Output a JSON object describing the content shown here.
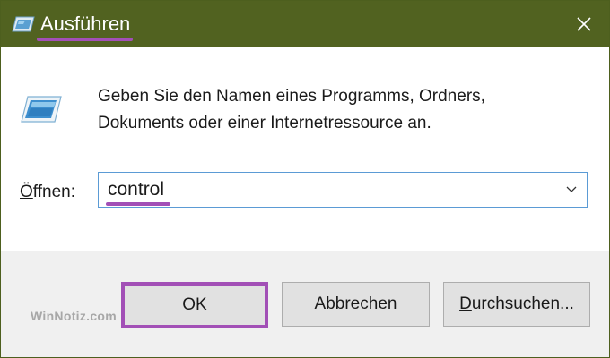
{
  "window": {
    "title": "Ausführen",
    "close_icon": "close-icon",
    "app_icon": "run-app-icon"
  },
  "content": {
    "icon": "run-dialog-icon",
    "description_line1": "Geben Sie den Namen eines Programms, Ordners,",
    "description_line2": "Dokuments oder einer Internetressource an.",
    "open_label_access_key": "Ö",
    "open_label_rest": "ffnen:",
    "open_value": "control",
    "dropdown_icon": "chevron-down-icon"
  },
  "buttons": {
    "ok_label": "OK",
    "cancel_label": "Abbrechen",
    "browse_access_key": "D",
    "browse_label_rest": "urchsuchen..."
  },
  "watermark": "WinNotiz.com",
  "colors": {
    "titlebar": "#516220",
    "highlight": "#a24fb6",
    "input_border": "#5b9bd5",
    "footer": "#f0f0f0"
  }
}
